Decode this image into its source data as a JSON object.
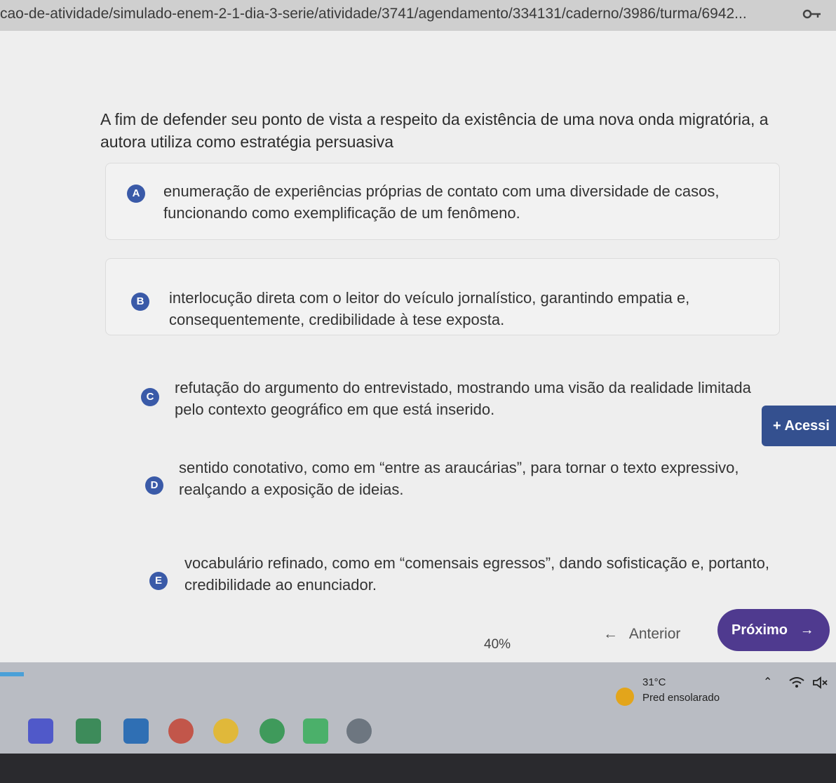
{
  "browser": {
    "url": "cao-de-atividade/simulado-enem-2-1-dia-3-serie/atividade/3741/agendamento/334131/caderno/3986/turma/6942...",
    "key_icon": "key-icon"
  },
  "question": {
    "text": "A fim de defender seu ponto de vista a respeito da existência de uma nova onda migratória, a autora utiliza como estratégia persuasiva"
  },
  "options": [
    {
      "letter": "A",
      "text": "enumeração de experiências próprias de contato com uma diversidade de casos, funcionando como exemplificação de um fenômeno."
    },
    {
      "letter": "B",
      "text": "interlocução direta com o leitor do veículo jornalístico, garantindo empatia e, consequentemente, credibilidade à tese exposta."
    },
    {
      "letter": "C",
      "text": "refutação do argumento do entrevistado, mostrando uma visão da realidade limitada pelo contexto geográfico em que está inserido."
    },
    {
      "letter": "D",
      "text": "sentido conotativo, como em “entre as araucárias”, para tornar o texto expressivo, realçando a exposição de ideias."
    },
    {
      "letter": "E",
      "text": "vocabulário refinado, como em “comensais egressos”, dando sofisticação e, portanto, credibilidade ao enunciador."
    }
  ],
  "accessibility": {
    "label": "+ Acessi"
  },
  "footer": {
    "progress": "40%",
    "prev_label": "Anterior",
    "next_label": "Próximo"
  },
  "taskbar": {
    "temperature": "31°C",
    "weather": "Pred ensolarado"
  },
  "colors": {
    "option_badge": "#3a5aa8",
    "next_button": "#4f3a8f",
    "access_button": "#34508f"
  }
}
